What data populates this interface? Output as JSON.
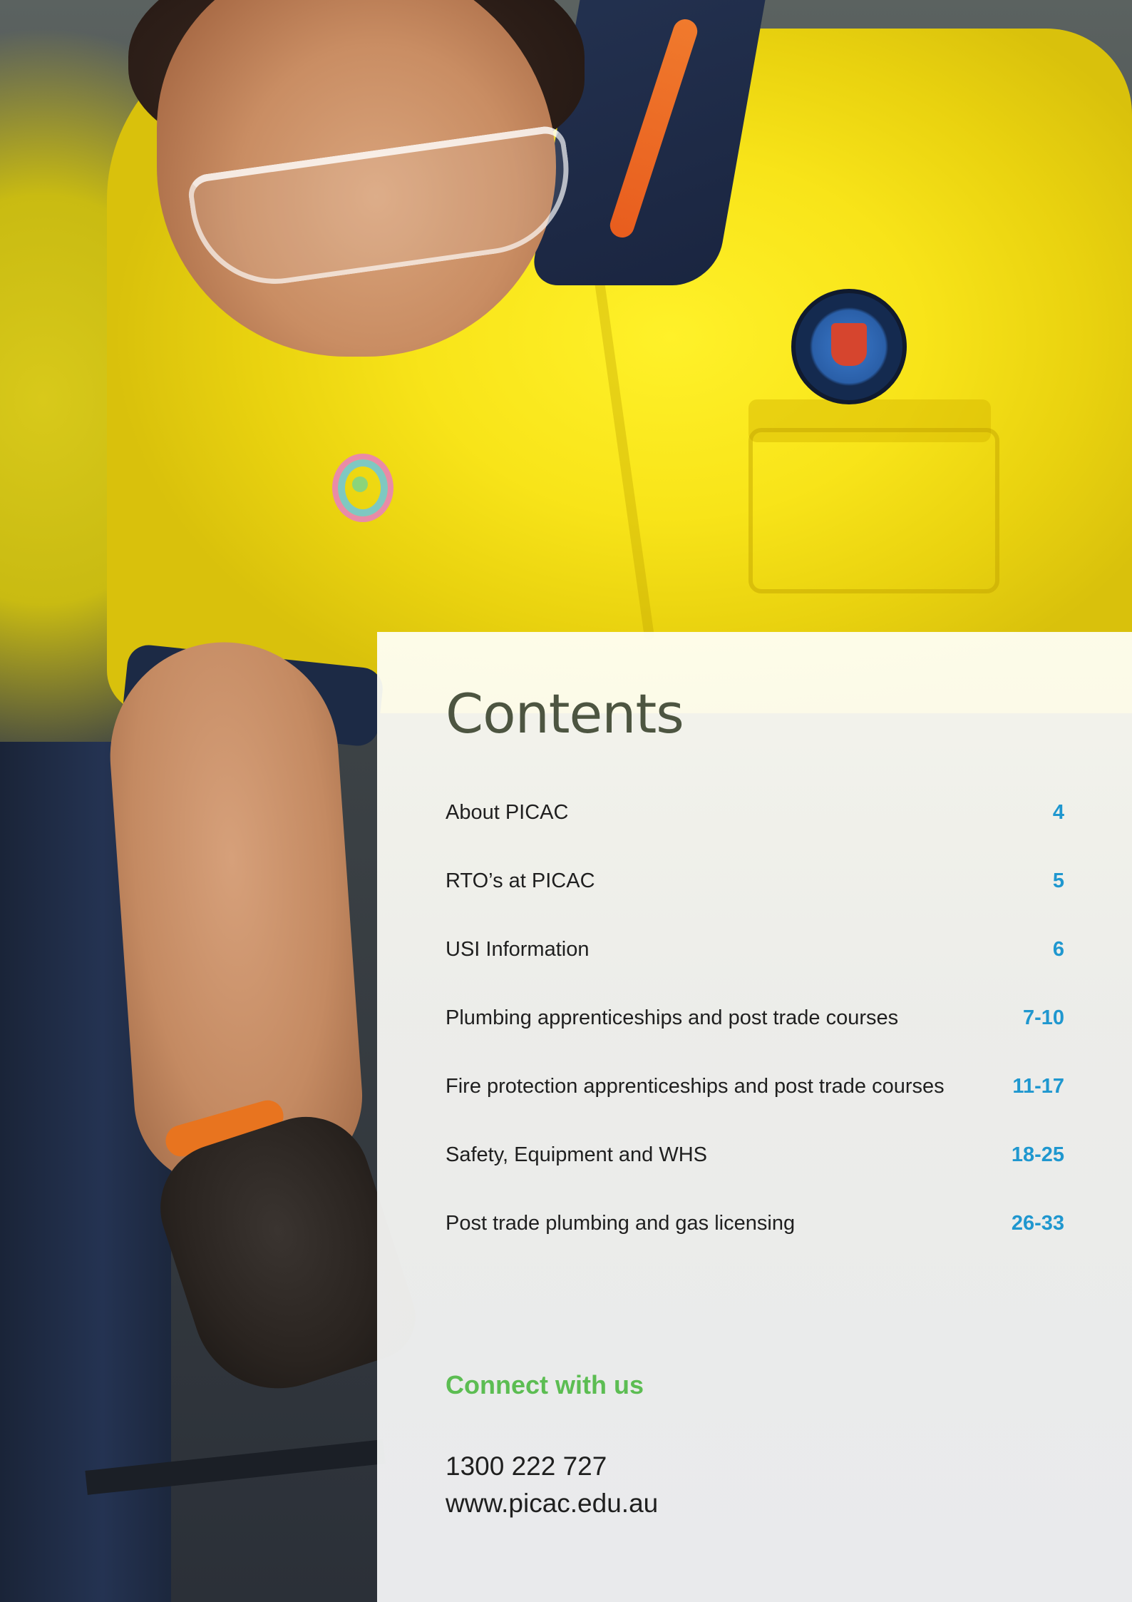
{
  "contents": {
    "title": "Contents",
    "items": [
      {
        "label": "About PICAC",
        "page": "4"
      },
      {
        "label": "RTO’s at PICAC",
        "page": "5"
      },
      {
        "label": "USI Information",
        "page": "6"
      },
      {
        "label": "Plumbing apprenticeships and post trade courses",
        "page": "7-10"
      },
      {
        "label": "Fire protection apprenticeships and post trade courses",
        "page": "11-17"
      },
      {
        "label": "Safety, Equipment and WHS",
        "page": "18-25"
      },
      {
        "label": "Post trade plumbing and gas licensing",
        "page": "26-33"
      }
    ]
  },
  "connect": {
    "title": "Connect with us",
    "phone": "1300 222 727",
    "website": "www.picac.edu.au"
  },
  "colors": {
    "title": "#4d5541",
    "page_number": "#1f97cf",
    "connect_heading": "#5cbd52",
    "shirt": "#f8e419"
  },
  "photo": {
    "subject": "apprentice-in-yellow-work-shirt-with-safety-glasses"
  }
}
